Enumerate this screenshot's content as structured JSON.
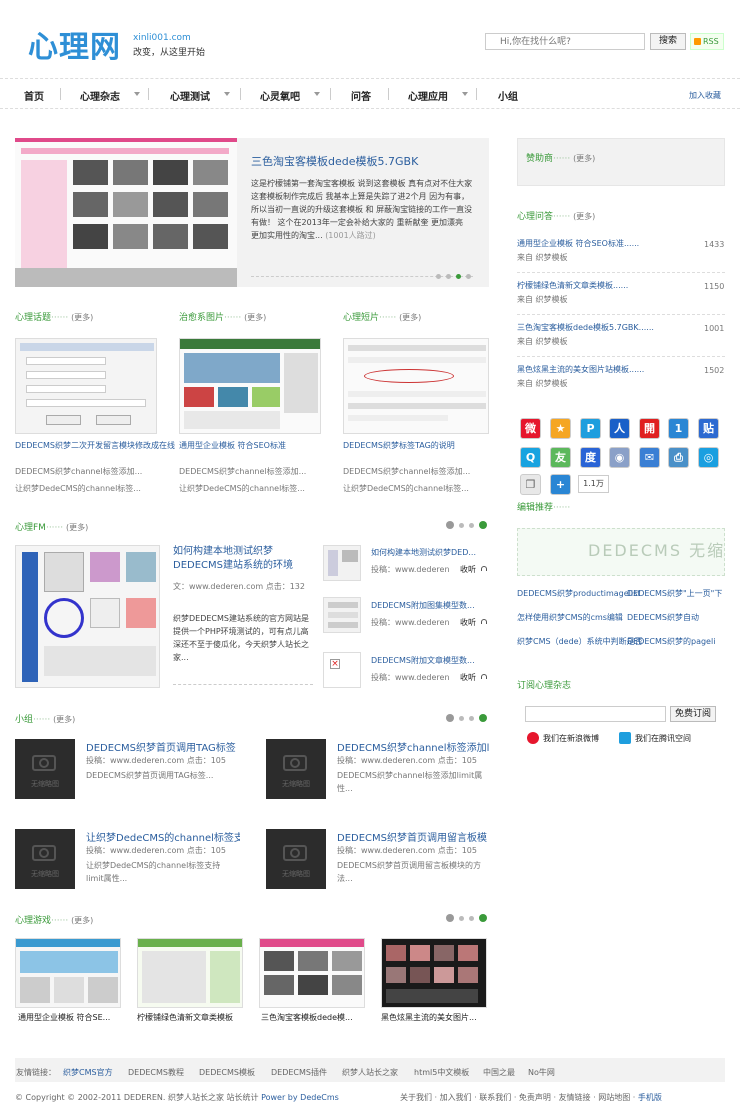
{
  "header": {
    "logo": "心理网",
    "site_url": "xinli001.com",
    "slogan": "改变，从这里开始",
    "search_placeholder": "Hi,你在找什么呢?",
    "search_button": "搜索",
    "rss": "RSS"
  },
  "nav": {
    "items": [
      {
        "label": "首页"
      },
      {
        "label": "心理杂志"
      },
      {
        "label": "心理测试"
      },
      {
        "label": "心灵氧吧"
      },
      {
        "label": "问答"
      },
      {
        "label": "心理应用"
      },
      {
        "label": "小组"
      }
    ],
    "bookmark": "加入收藏"
  },
  "featured": {
    "title": "三色淘宝客模板dede模板5.7GBK",
    "desc": "这是柠檬铺第一套淘宝客模板 说到这套模板 真有点对不住大家 这套模板制作完成后 我基本上算是失踪了进2个月 因为有事，所以当初一直说的升级这套模板 和 屏蔽淘宝链接的工作一直没有做！ 这个在2013年一定会补给大家的 重新献奎 更加漂亮 更加实用性的淘宝...",
    "count": "(1001人路过)"
  },
  "topics": {
    "title": "心理话题",
    "more": "(更多)",
    "link": "DEDECMS织梦二次开发留言模块修改成在线报名预约",
    "desc1": "DEDECMS织梦channel标签添加...",
    "desc2": "让织梦DedeCMS的channel标签..."
  },
  "healing": {
    "title": "治愈系图片",
    "more": "(更多)",
    "link": "通用型企业模板 符合SEO标准",
    "desc1": "DEDECMS织梦channel标签添加...",
    "desc2": "让织梦DedeCMS的channel标签..."
  },
  "shorts": {
    "title": "心理短片",
    "more": "(更多)",
    "link": "DEDECMS织梦标签TAG的说明",
    "desc1": "DEDECMS织梦channel标签添加...",
    "desc2": "让织梦DedeCMS的channel标签..."
  },
  "fm": {
    "title": "心理FM",
    "more": "(更多)",
    "main_title": "如何构建本地测试织梦DEDECMS建站系统的环境",
    "main_meta": "文：www.dederen.com  点击：132",
    "main_desc": "织梦DEDECMS建站系统的官方网站是提供一个PHP环境测试的，可有点儿高深还不至于傻瓜化，今天织梦人站长之家...",
    "items": [
      {
        "title": "如何构建本地测试织梦DED...",
        "meta": "投稿：www.dederen",
        "act": "收听"
      },
      {
        "title": "DEDECMS附加图集模型数...",
        "meta": "投稿：www.dederen",
        "act": "收听"
      },
      {
        "title": "DEDECMS附加文章模型数...",
        "meta": "投稿：www.dederen",
        "act": "收听"
      }
    ]
  },
  "group": {
    "title": "小组",
    "more": "(更多)",
    "noimg": "无缩略图",
    "items": [
      {
        "title": "DEDECMS织梦首页调用TAG标签",
        "meta": "投稿：www.dederen.com  点击：105",
        "desc": "DEDECMS织梦首页调用TAG标签..."
      },
      {
        "title": "DEDECMS织梦channel标签添加l",
        "meta": "投稿：www.dederen.com  点击：105",
        "desc": "DEDECMS织梦channel标签添加limit属性..."
      },
      {
        "title": "让织梦DedeCMS的channel标签支",
        "meta": "投稿：www.dederen.com  点击：105",
        "desc": "让织梦DedeCMS的channel标签支持limit属性..."
      },
      {
        "title": "DEDECMS织梦首页调用留言板模",
        "meta": "投稿：www.dederen.com  点击：105",
        "desc": "DEDECMS织梦首页调用留言板模块的方法..."
      }
    ]
  },
  "games": {
    "title": "心理游戏",
    "more": "(更多)",
    "items": [
      {
        "label": "通用型企业模板 符合SE..."
      },
      {
        "label": "柠檬铺绿色清新文章类模板"
      },
      {
        "label": "三色淘宝客模板dede模..."
      },
      {
        "label": "黑色炫黑主流的美女图片..."
      }
    ]
  },
  "sidebar": {
    "sponsor": "赞助商",
    "sponsor_more": "(更多)",
    "qa_title": "心理问答",
    "qa_more": "(更多)",
    "qa": [
      {
        "title": "通用型企业模板 符合SEO标准......",
        "src": "来自 织梦模板",
        "count": "1433"
      },
      {
        "title": "柠檬铺绿色清新文章类模板......",
        "src": "来自 织梦模板",
        "count": "1150"
      },
      {
        "title": "三色淘宝客模板dede模板5.7GBK......",
        "src": "来自 织梦模板",
        "count": "1001"
      },
      {
        "title": "黑色炫黑主流的美女图片站模板......",
        "src": "来自 织梦模板",
        "count": "1502"
      }
    ],
    "share_count": "1.1万",
    "editor_title": "编辑推荐",
    "editor_banner": "DEDECMS 无缩略图",
    "editor_links": [
      {
        "a": "DEDECMS织梦productimagelist",
        "b": "DEDECMS织梦\"上一页\"下"
      },
      {
        "a": "怎样使用织梦CMS的cms编辑",
        "b": "DEDECMS织梦自动"
      },
      {
        "a": "织梦CMS（dede）系统中判断是否",
        "b": "DEDECMS织梦的pageli"
      }
    ],
    "subscribe_title": "订阅心理杂志",
    "subscribe_button": "免费订阅",
    "weibo": "我们在新浪微博",
    "qzone": "我们在腾讯空间"
  },
  "footer": {
    "links_label": "友情链接：",
    "links": [
      "织梦CMS官方",
      "DEDECMS教程",
      "DEDECMS模板",
      "DEDECMS插件",
      "织梦人站长之家",
      "html5中文模板",
      "中国之最",
      "No牛网"
    ],
    "copyright": "© Copyright © 2002-2011 DEDEREN. 织梦人站长之家 站长统计",
    "powered": "Power by DedeCms",
    "bottom_links": [
      "关于我们",
      "加入我们",
      "联系我们",
      "免责声明",
      "友情链接",
      "网站地图",
      "手机版"
    ]
  },
  "colors": {
    "accent": "#2e8fd6",
    "green": "#3a9a3a",
    "link": "#2b5e9e"
  }
}
